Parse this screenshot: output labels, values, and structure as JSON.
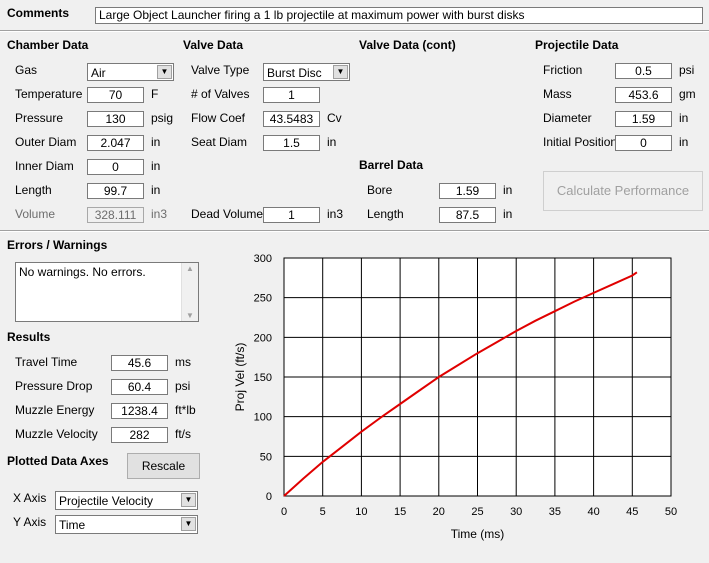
{
  "comments": {
    "label": "Comments",
    "value": "Large Object Launcher firing a 1 lb projectile at maximum power with burst disks"
  },
  "chamber": {
    "title": "Chamber Data",
    "gas_label": "Gas",
    "gas_value": "Air",
    "temperature_label": "Temperature",
    "temperature_value": "70",
    "temperature_unit": "F",
    "pressure_label": "Pressure",
    "pressure_value": "130",
    "pressure_unit": "psig",
    "outer_diam_label": "Outer Diam",
    "outer_diam_value": "2.047",
    "outer_diam_unit": "in",
    "inner_diam_label": "Inner Diam",
    "inner_diam_value": "0",
    "inner_diam_unit": "in",
    "length_label": "Length",
    "length_value": "99.7",
    "length_unit": "in",
    "volume_label": "Volume",
    "volume_value": "328.111",
    "volume_unit": "in3"
  },
  "valve": {
    "title": "Valve Data",
    "type_label": "Valve Type",
    "type_value": "Burst Disc",
    "num_label": "# of Valves",
    "num_value": "1",
    "flow_label": "Flow Coef",
    "flow_value": "43.5483",
    "flow_unit": "Cv",
    "seat_label": "Seat Diam",
    "seat_value": "1.5",
    "seat_unit": "in",
    "dead_label": "Dead Volume",
    "dead_value": "1",
    "dead_unit": "in3"
  },
  "valve_cont": {
    "title": "Valve Data (cont)"
  },
  "barrel": {
    "title": "Barrel Data",
    "bore_label": "Bore",
    "bore_value": "1.59",
    "bore_unit": "in",
    "length_label": "Length",
    "length_value": "87.5",
    "length_unit": "in"
  },
  "projectile": {
    "title": "Projectile Data",
    "friction_label": "Friction",
    "friction_value": "0.5",
    "friction_unit": "psi",
    "mass_label": "Mass",
    "mass_value": "453.6",
    "mass_unit": "gm",
    "diameter_label": "Diameter",
    "diameter_value": "1.59",
    "diameter_unit": "in",
    "initpos_label": "Initial Position",
    "initpos_value": "0",
    "initpos_unit": "in"
  },
  "calc_button": "Calculate Performance",
  "errors": {
    "title": "Errors / Warnings",
    "text": "No warnings.  No errors."
  },
  "results": {
    "title": "Results",
    "travel_label": "Travel Time",
    "travel_value": "45.6",
    "travel_unit": "ms",
    "pdrop_label": "Pressure Drop",
    "pdrop_value": "60.4",
    "pdrop_unit": "psi",
    "energy_label": "Muzzle Energy",
    "energy_value": "1238.4",
    "energy_unit": "ft*lb",
    "velocity_label": "Muzzle Velocity",
    "velocity_value": "282",
    "velocity_unit": "ft/s"
  },
  "axes": {
    "title": "Plotted Data Axes",
    "rescale_button": "Rescale",
    "x_label": "X Axis",
    "x_value": "Projectile Velocity",
    "y_label": "Y Axis",
    "y_value": "Time"
  },
  "chart_data": {
    "type": "line",
    "xlabel": "Time (ms)",
    "ylabel": "Proj Vel (ft/s)",
    "xlim": [
      0,
      50
    ],
    "ylim": [
      0,
      300
    ],
    "xticks": [
      "0",
      "5",
      "10",
      "15",
      "20",
      "25",
      "30",
      "35",
      "40",
      "45",
      "50"
    ],
    "yticks": [
      "0",
      "50",
      "100",
      "150",
      "200",
      "250",
      "300"
    ],
    "grid": true,
    "line_color": "#e00000",
    "series": [
      {
        "x": [
          0,
          2.5,
          5,
          7.5,
          10,
          12.5,
          15,
          17.5,
          20,
          22.5,
          25,
          27.5,
          30,
          32.5,
          35,
          37.5,
          40,
          42.5,
          45,
          45.6
        ],
        "y": [
          0,
          22,
          43,
          62,
          81,
          99,
          116,
          133,
          150,
          165,
          180,
          194,
          208,
          221,
          233,
          245,
          256,
          267,
          278,
          282
        ]
      }
    ]
  }
}
